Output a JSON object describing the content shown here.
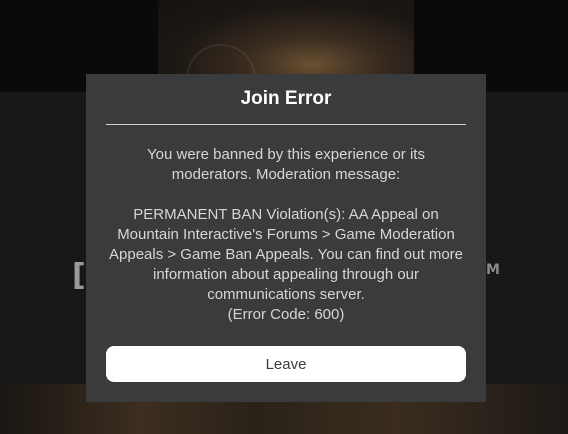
{
  "background": {
    "left_text": "[",
    "right_text": "M"
  },
  "dialog": {
    "title": "Join Error",
    "message_intro_1": "You were banned by this experience or its",
    "message_intro_2": "moderators. Moderation message:",
    "message_body_1": "PERMANENT BAN Violation(s): AA Appeal on",
    "message_body_2": "Mountain Interactive's Forums > Game Moderation",
    "message_body_3": "Appeals > Game Ban Appeals. You can find out more",
    "message_body_4": "information about appealing through our",
    "message_body_5": "communications server.",
    "error_code": "(Error Code: 600)",
    "leave_label": "Leave"
  },
  "colors": {
    "dialog_bg": "#393b3d",
    "button_bg": "#ffffff",
    "title_text": "#ffffff"
  }
}
